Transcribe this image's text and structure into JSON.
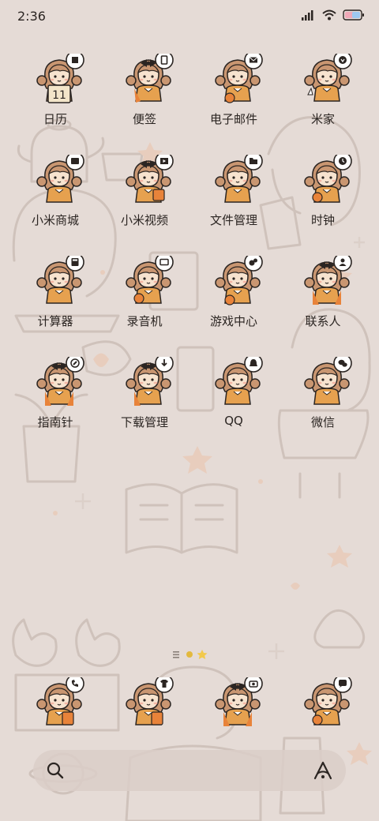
{
  "status_bar": {
    "time": "2:36",
    "icons": [
      "signal-icon",
      "wifi-icon",
      "battery-icon"
    ]
  },
  "apps": [
    {
      "label": "日历",
      "badge": "calendar-icon",
      "date": "11"
    },
    {
      "label": "便签",
      "badge": "note-icon"
    },
    {
      "label": "电子邮件",
      "badge": "mail-icon"
    },
    {
      "label": "米家",
      "badge": "mihome-icon"
    },
    {
      "label": "小米商城",
      "badge": "store-icon"
    },
    {
      "label": "小米视频",
      "badge": "video-icon"
    },
    {
      "label": "文件管理",
      "badge": "folder-icon"
    },
    {
      "label": "时钟",
      "badge": "clock-icon"
    },
    {
      "label": "计算器",
      "badge": "calculator-icon"
    },
    {
      "label": "录音机",
      "badge": "recorder-icon"
    },
    {
      "label": "游戏中心",
      "badge": "game-icon"
    },
    {
      "label": "联系人",
      "badge": "contact-icon"
    },
    {
      "label": "指南针",
      "badge": "compass-icon"
    },
    {
      "label": "下载管理",
      "badge": "download-icon"
    },
    {
      "label": "QQ",
      "badge": "qq-icon"
    },
    {
      "label": "微信",
      "badge": "wechat-icon"
    }
  ],
  "dock": [
    {
      "badge": "phone-icon"
    },
    {
      "badge": "shirt-icon"
    },
    {
      "badge": "camera-icon"
    },
    {
      "badge": "message-icon"
    }
  ],
  "page_indicator": {
    "pages": 2,
    "current": 0
  },
  "search_bar": {
    "left_icon": "search-icon",
    "right_icon": "assistant-icon"
  },
  "colors": {
    "background": "#e5dbd6",
    "hair": "#c99671",
    "skin": "#f7e3cf",
    "shirt": "#e6a14f",
    "orange": "#e8833a",
    "line": "#2b2522"
  }
}
